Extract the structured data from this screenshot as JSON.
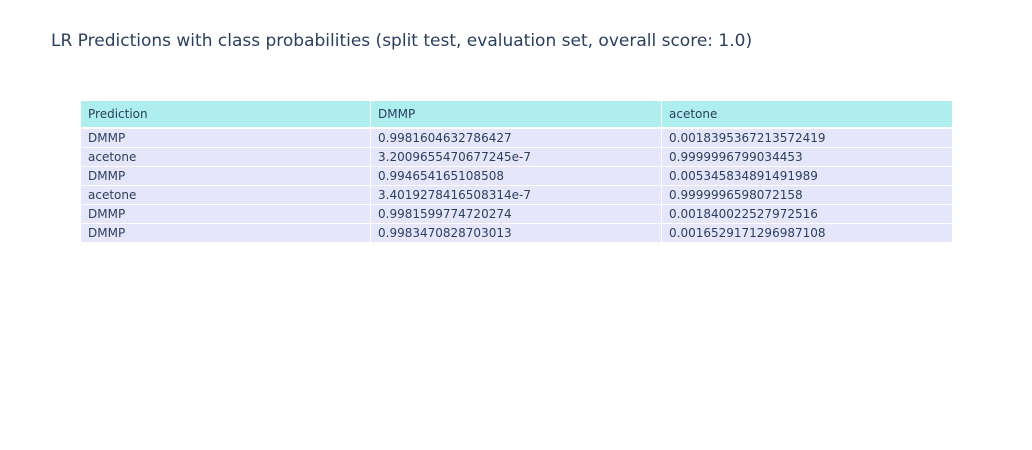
{
  "colors": {
    "header_fill": "#afeeee",
    "cell_fill": "#e6e6fa",
    "text": "#2a3f5f"
  },
  "chart_data": {
    "type": "table",
    "title": "LR Predictions with class probabilities (split test, evaluation set, overall score: 1.0)",
    "columns": [
      "Prediction",
      "DMMP",
      "acetone"
    ],
    "rows": [
      [
        "DMMP",
        "0.9981604632786427",
        "0.0018395367213572419"
      ],
      [
        "acetone",
        "3.2009655470677245e-7",
        "0.9999996799034453"
      ],
      [
        "DMMP",
        "0.994654165108508",
        "0.005345834891491989"
      ],
      [
        "acetone",
        "3.4019278416508314e-7",
        "0.9999996598072158"
      ],
      [
        "DMMP",
        "0.9981599774720274",
        "0.001840022527972516"
      ],
      [
        "DMMP",
        "0.9983470828703013",
        "0.0016529171296987108"
      ]
    ]
  }
}
